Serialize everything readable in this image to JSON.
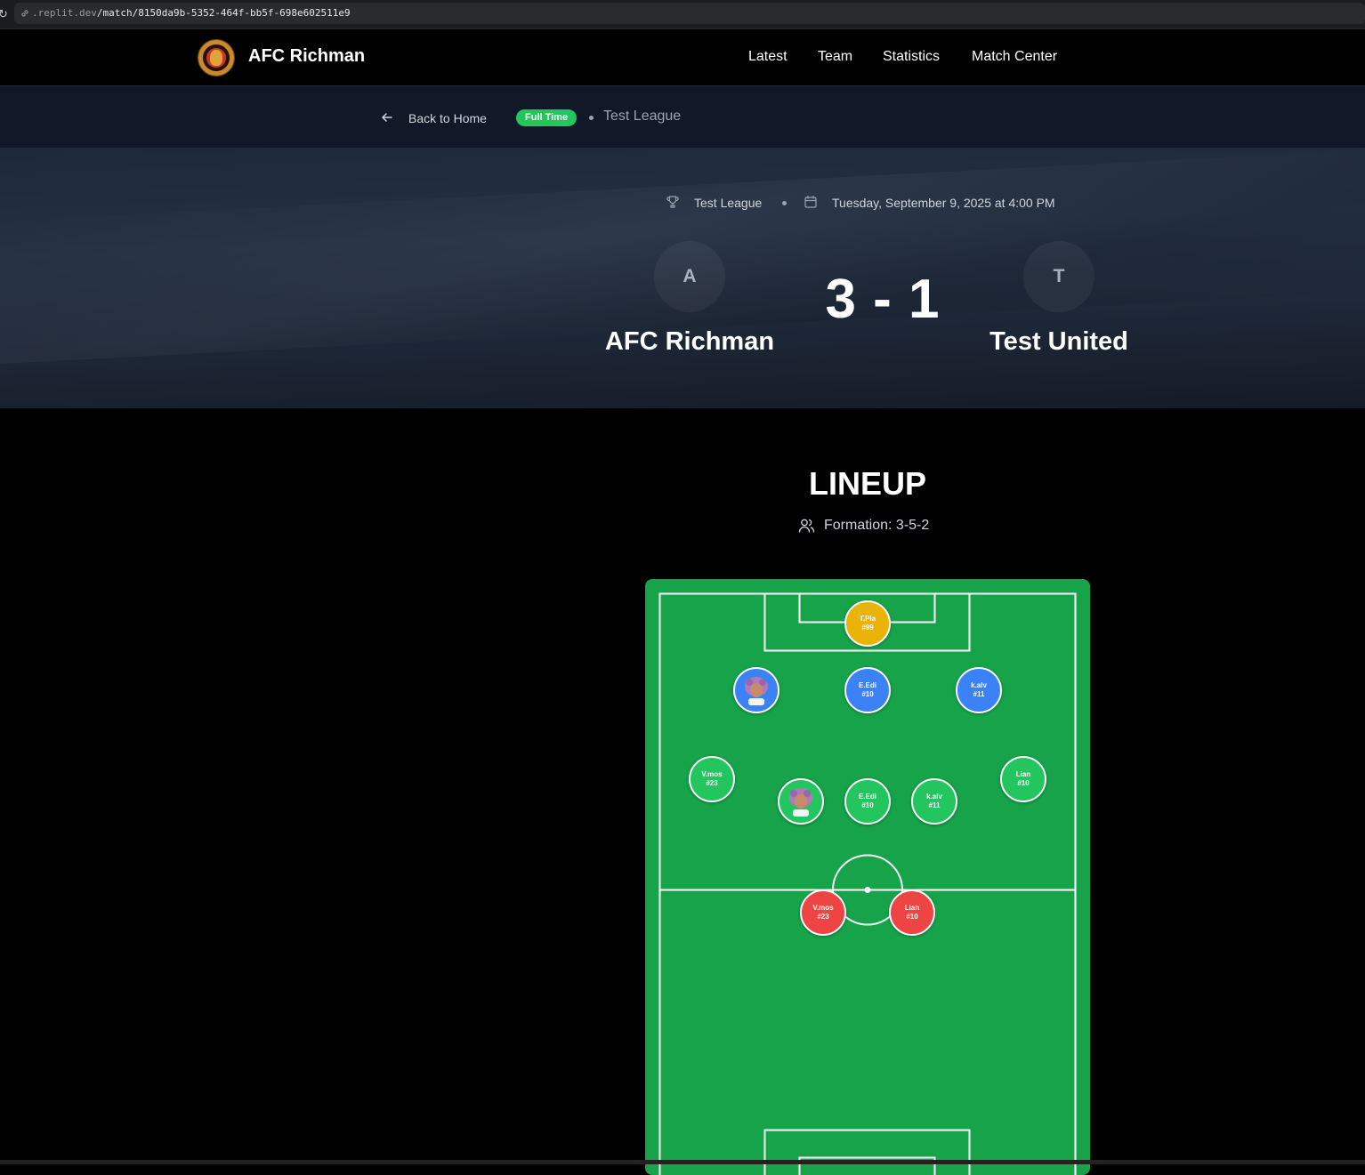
{
  "browser": {
    "url_host": ".replit.dev",
    "url_path": "/match/8150da9b-5352-464f-bb5f-698e602511e9"
  },
  "header": {
    "brand": "AFC Richman",
    "nav": [
      "Latest",
      "Team",
      "Statistics",
      "Match Center"
    ]
  },
  "breadcrumb": {
    "back_label": "Back to Home",
    "status_badge": "Full Time",
    "league": "Test League"
  },
  "match": {
    "league": "Test League",
    "datetime": "Tuesday, September 9, 2025 at 4:00 PM",
    "home_initial": "A",
    "home_team": "AFC Richman",
    "away_initial": "T",
    "away_team": "Test United",
    "score": "3 - 1"
  },
  "lineup": {
    "title": "LINEUP",
    "formation": "Formation: 3-5-2",
    "players": [
      {
        "name": "T.Pla",
        "number": "#99",
        "role": "gk",
        "has_photo": false
      },
      {
        "name": "",
        "number": "",
        "role": "def",
        "has_photo": true
      },
      {
        "name": "E.Edi",
        "number": "#10",
        "role": "def",
        "has_photo": false
      },
      {
        "name": "k.alv",
        "number": "#11",
        "role": "def",
        "has_photo": false
      },
      {
        "name": "V.mos",
        "number": "#23",
        "role": "mid",
        "has_photo": false
      },
      {
        "name": "",
        "number": "",
        "role": "mid",
        "has_photo": true
      },
      {
        "name": "E.Edi",
        "number": "#10",
        "role": "mid",
        "has_photo": false
      },
      {
        "name": "k.alv",
        "number": "#11",
        "role": "mid",
        "has_photo": false
      },
      {
        "name": "Lian",
        "number": "#10",
        "role": "mid",
        "has_photo": false
      },
      {
        "name": "V.mos",
        "number": "#23",
        "role": "fwd",
        "has_photo": false
      },
      {
        "name": "Lian",
        "number": "#10",
        "role": "fwd",
        "has_photo": false
      }
    ]
  },
  "colors": {
    "badge": "#22c55e",
    "pitch": "#16a34a",
    "gk": "#eab308",
    "def": "#3b82f6",
    "mid": "#22c55e",
    "fwd": "#ef4444"
  }
}
